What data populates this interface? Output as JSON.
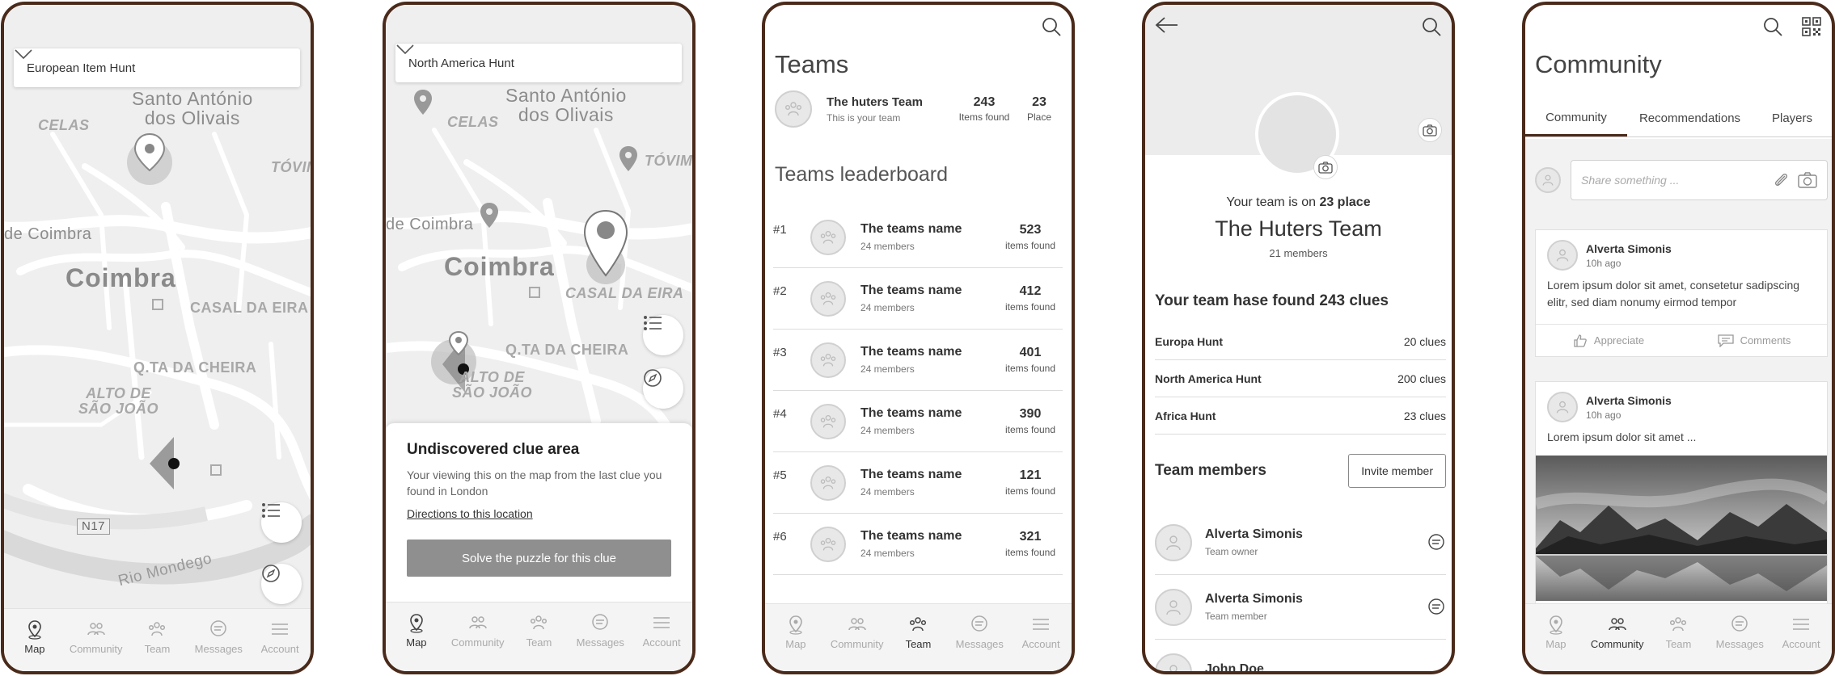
{
  "nav": {
    "map": "Map",
    "community": "Community",
    "team": "Team",
    "messages": "Messages",
    "account": "Account"
  },
  "screen1": {
    "dropdown": "European Item Hunt",
    "labels": {
      "santo": "Santo António\ndos Olivais",
      "celas": "CELAS",
      "tovim": "TÓVIM",
      "decoimbra": "de Coimbra",
      "coimbra": "Coimbra",
      "casal": "CASAL DA EIRA",
      "qta": "Q.TA DA CHEIRA",
      "alto": "ALTO DE\nSÃO JOÃO",
      "n17": "N17",
      "rio": "Rio Mondego"
    }
  },
  "screen2": {
    "dropdown": "North America Hunt",
    "labels": {
      "santo": "Santo António\ndos Olivais",
      "celas": "CELAS",
      "tovim": "TÓVIM",
      "decoimbra": "de Coimbra",
      "coimbra": "Coimbra",
      "casal": "CASAL DA EIRA",
      "qta": "Q.TA DA CHEIRA",
      "alto": "ALTO DE\nSÃO JOÃO"
    },
    "card": {
      "title": "Undiscovered clue area",
      "text": "Your viewing this on the map from the last clue you found in London",
      "link": "Directions to this location",
      "button": "Solve the puzzle for this clue"
    }
  },
  "screen3": {
    "title": "Teams",
    "my_team": {
      "name": "The huters Team",
      "sub": "This is your team",
      "items": "243",
      "items_label": "Items found",
      "place": "23",
      "place_label": "Place"
    },
    "leaderboard_title": "Teams leaderboard",
    "leaderboard": [
      {
        "rank": "#1",
        "name": "The teams name",
        "members": "24 members",
        "items": "523",
        "items_label": "items found"
      },
      {
        "rank": "#2",
        "name": "The teams name",
        "members": "24 members",
        "items": "412",
        "items_label": "items found"
      },
      {
        "rank": "#3",
        "name": "The teams name",
        "members": "24 members",
        "items": "401",
        "items_label": "items found"
      },
      {
        "rank": "#4",
        "name": "The teams name",
        "members": "24 members",
        "items": "390",
        "items_label": "items found"
      },
      {
        "rank": "#5",
        "name": "The teams name",
        "members": "24 members",
        "items": "121",
        "items_label": "items found"
      },
      {
        "rank": "#6",
        "name": "The teams name",
        "members": "24 members",
        "items": "321",
        "items_label": "items found"
      }
    ]
  },
  "screen4": {
    "place_prefix": "Your team is on ",
    "place_value": "23 place",
    "team_name": "The Huters Team",
    "members_count": "21 members",
    "clues_heading": "Your team hase found 243 clues",
    "clues": [
      {
        "hunt": "Europa Hunt",
        "count": "20 clues"
      },
      {
        "hunt": "North America Hunt",
        "count": "200 clues"
      },
      {
        "hunt": "Africa Hunt",
        "count": "23 clues"
      }
    ],
    "members_heading": "Team members",
    "invite_button": "Invite member",
    "members": [
      {
        "name": "Alverta Simonis",
        "role": "Team owner"
      },
      {
        "name": "Alverta Simonis",
        "role": "Team member"
      },
      {
        "name": "John Doe",
        "role": ""
      }
    ]
  },
  "screen5": {
    "title": "Community",
    "tabs": [
      "Community",
      "Recommendations",
      "Players"
    ],
    "composer_placeholder": "Share something ...",
    "posts": [
      {
        "author": "Alverta Simonis",
        "time": "10h ago",
        "text": "Lorem ipsum dolor sit amet, consetetur sadipscing elitr, sed diam nonumy eirmod tempor",
        "appreciate": "Appreciate",
        "comments": "Comments"
      },
      {
        "author": "Alverta Simonis",
        "time": "10h ago",
        "text": "Lorem ipsum dolor sit amet ..."
      }
    ]
  }
}
